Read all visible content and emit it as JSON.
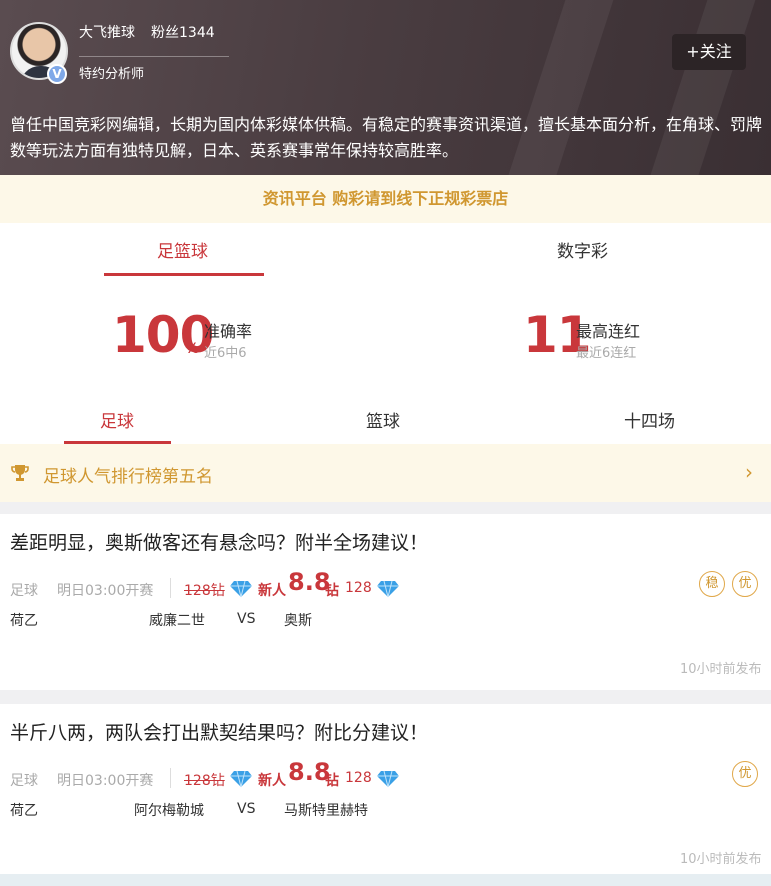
{
  "profile": {
    "name": "大飞推球",
    "fans": "粉丝1344",
    "title": "特约分析师",
    "follow_label": "+关注",
    "bio": "曾任中国竞彩网编辑，长期为国内体彩媒体供稿。有稳定的赛事资讯渠道，擅长基本面分析，在角球、罚牌数等玩法方面有独特见解，日本、英系赛事常年保持较高胜率。"
  },
  "notice": "资讯平台 购彩请到线下正规彩票店",
  "main_tabs": [
    {
      "label": "足篮球",
      "active": true
    },
    {
      "label": "数字彩",
      "active": false
    }
  ],
  "stats": {
    "accuracy": {
      "value": "100",
      "unit": "%",
      "label": "准确率",
      "sub": "近6中6"
    },
    "streak": {
      "value": "11",
      "label": "最高连红",
      "sub": "最近6连红"
    }
  },
  "sub_tabs": [
    {
      "label": "足球",
      "active": true
    },
    {
      "label": "篮球",
      "active": false
    },
    {
      "label": "十四场",
      "active": false
    }
  ],
  "rank_banner": "足球人气排行榜第五名",
  "articles": [
    {
      "headline": "差距明显，奥斯做客还有悬念吗？附半全场建议！",
      "sport": "足球",
      "time": "明日03:00开赛",
      "old_price": "128钻",
      "new_label": "新人",
      "new_price": "8.8",
      "new_unit": "钻",
      "price2": "128",
      "league": "荷乙",
      "home": "威廉二世",
      "vs": "VS",
      "away": "奥斯",
      "tags": [
        "稳",
        "优"
      ],
      "posted": "10小时前发布"
    },
    {
      "headline": "半斤八两，两队会打出默契结果吗？附比分建议！",
      "sport": "足球",
      "time": "明日03:00开赛",
      "old_price": "128钻",
      "new_label": "新人",
      "new_price": "8.8",
      "new_unit": "钻",
      "price2": "128",
      "league": "荷乙",
      "home": "阿尔梅勒城",
      "vs": "VS",
      "away": "马斯特里赫特",
      "tags": [
        "优"
      ],
      "posted": "10小时前发布"
    }
  ],
  "colors": {
    "accent": "#c9373b",
    "gold": "#d09730",
    "diamond": "#3aa0e6"
  }
}
